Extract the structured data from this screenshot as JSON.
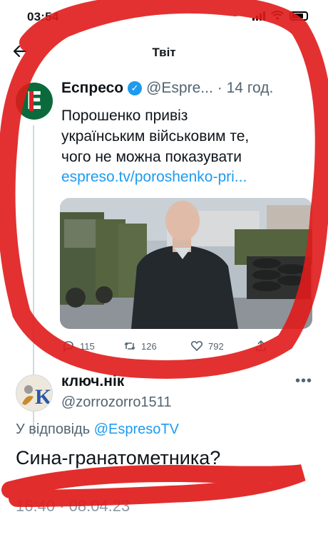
{
  "status": {
    "time": "03:54"
  },
  "nav": {
    "title": "Твіт",
    "back_icon": "arrow-left-icon"
  },
  "quoted_tweet": {
    "name": "Еспресо",
    "handle": "@Espre...",
    "time": "· 14 год.",
    "text_lines": [
      "Порошенко привіз",
      "українським військовим те,",
      "чого не можна показувати"
    ],
    "link": "espreso.tv/poroshenko-pri...",
    "stats": {
      "replies": "115",
      "retweets": "126",
      "likes": "792"
    }
  },
  "reply_tweet": {
    "name": "ключ.нік",
    "handle": "@zorrozorro1511",
    "in_reply_prefix": "У відповідь",
    "in_reply_handle": "@EspresoTV",
    "text": "Сина-гранатометника?",
    "timestamp": "16:40 · 08.04.23"
  },
  "colors": {
    "link": "#1d9bf0",
    "scribble": "#e01b1b",
    "brand_green": "#0b6a3b"
  }
}
